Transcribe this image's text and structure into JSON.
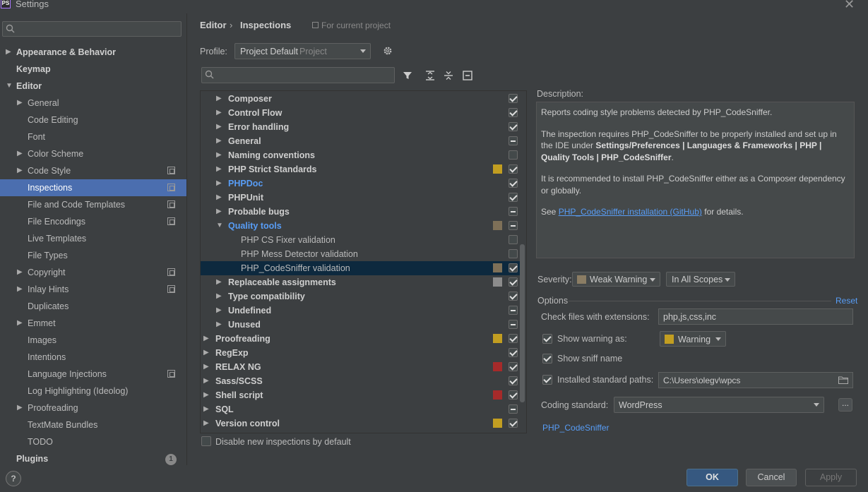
{
  "window": {
    "title": "Settings",
    "logo_text": "PS"
  },
  "sidebar": {
    "search_placeholder": "",
    "items": [
      {
        "label": "Appearance & Behavior",
        "bold": true,
        "arrow": "▶",
        "indent": 0
      },
      {
        "label": "Keymap",
        "bold": true,
        "arrow": "",
        "indent": 0
      },
      {
        "label": "Editor",
        "bold": true,
        "arrow": "▼",
        "indent": 0
      },
      {
        "label": "General",
        "arrow": "▶",
        "indent": 1
      },
      {
        "label": "Code Editing",
        "arrow": "",
        "indent": 1
      },
      {
        "label": "Font",
        "arrow": "",
        "indent": 1
      },
      {
        "label": "Color Scheme",
        "arrow": "▶",
        "indent": 1
      },
      {
        "label": "Code Style",
        "arrow": "▶",
        "indent": 1,
        "project": true
      },
      {
        "label": "Inspections",
        "arrow": "",
        "indent": 1,
        "project": true,
        "selected": true
      },
      {
        "label": "File and Code Templates",
        "arrow": "",
        "indent": 1,
        "project": true
      },
      {
        "label": "File Encodings",
        "arrow": "",
        "indent": 1,
        "project": true
      },
      {
        "label": "Live Templates",
        "arrow": "",
        "indent": 1
      },
      {
        "label": "File Types",
        "arrow": "",
        "indent": 1
      },
      {
        "label": "Copyright",
        "arrow": "▶",
        "indent": 1,
        "project": true
      },
      {
        "label": "Inlay Hints",
        "arrow": "▶",
        "indent": 1,
        "project": true
      },
      {
        "label": "Duplicates",
        "arrow": "",
        "indent": 1
      },
      {
        "label": "Emmet",
        "arrow": "▶",
        "indent": 1
      },
      {
        "label": "Images",
        "arrow": "",
        "indent": 1
      },
      {
        "label": "Intentions",
        "arrow": "",
        "indent": 1
      },
      {
        "label": "Language Injections",
        "arrow": "",
        "indent": 1,
        "project": true
      },
      {
        "label": "Log Highlighting (Ideolog)",
        "arrow": "",
        "indent": 1
      },
      {
        "label": "Proofreading",
        "arrow": "▶",
        "indent": 1
      },
      {
        "label": "TextMate Bundles",
        "arrow": "",
        "indent": 1
      },
      {
        "label": "TODO",
        "arrow": "",
        "indent": 1
      },
      {
        "label": "Plugins",
        "bold": true,
        "arrow": "",
        "indent": 0
      }
    ],
    "plugins_badge": "1"
  },
  "header": {
    "breadcrumb": [
      "Editor",
      "Inspections"
    ],
    "breadcrumb_sep": "›",
    "scope_note": "For current project"
  },
  "profile": {
    "label": "Profile:",
    "value": "Project Default",
    "scope": "Project"
  },
  "inspections": {
    "search_placeholder": "",
    "rows": [
      {
        "label": "Composer",
        "indent": 1,
        "arrow": "▶",
        "bold": true,
        "state": "checked",
        "severity": ""
      },
      {
        "label": "Control Flow",
        "indent": 1,
        "arrow": "▶",
        "bold": true,
        "state": "checked",
        "severity": ""
      },
      {
        "label": "Error handling",
        "indent": 1,
        "arrow": "▶",
        "bold": true,
        "state": "checked",
        "severity": ""
      },
      {
        "label": "General",
        "indent": 1,
        "arrow": "▶",
        "bold": true,
        "state": "partial",
        "severity": ""
      },
      {
        "label": "Naming conventions",
        "indent": 1,
        "arrow": "▶",
        "bold": true,
        "state": "unchecked",
        "severity": ""
      },
      {
        "label": "PHP Strict Standards",
        "indent": 1,
        "arrow": "▶",
        "bold": true,
        "state": "checked",
        "severity": "#c29e21"
      },
      {
        "label": "PHPDoc",
        "indent": 1,
        "arrow": "▶",
        "bold": true,
        "blue": true,
        "state": "checked",
        "severity": ""
      },
      {
        "label": "PHPUnit",
        "indent": 1,
        "arrow": "▶",
        "bold": true,
        "state": "checked",
        "severity": ""
      },
      {
        "label": "Probable bugs",
        "indent": 1,
        "arrow": "▶",
        "bold": true,
        "state": "partial",
        "severity": ""
      },
      {
        "label": "Quality tools",
        "indent": 1,
        "arrow": "▼",
        "bold": true,
        "blue": true,
        "state": "partial",
        "severity": "#7e7058"
      },
      {
        "label": "PHP CS Fixer validation",
        "indent": 2,
        "arrow": "",
        "state": "unchecked",
        "severity": ""
      },
      {
        "label": "PHP Mess Detector validation",
        "indent": 2,
        "arrow": "",
        "state": "unchecked",
        "severity": ""
      },
      {
        "label": "PHP_CodeSniffer validation",
        "indent": 2,
        "arrow": "",
        "state": "checked",
        "severity": "#7e7058",
        "selected": true
      },
      {
        "label": "Replaceable assignments",
        "indent": 1,
        "arrow": "▶",
        "bold": true,
        "state": "checked",
        "severity": "#8c8c8c"
      },
      {
        "label": "Type compatibility",
        "indent": 1,
        "arrow": "▶",
        "bold": true,
        "state": "checked",
        "severity": ""
      },
      {
        "label": "Undefined",
        "indent": 1,
        "arrow": "▶",
        "bold": true,
        "state": "partial",
        "severity": ""
      },
      {
        "label": "Unused",
        "indent": 1,
        "arrow": "▶",
        "bold": true,
        "state": "partial",
        "severity": ""
      },
      {
        "label": "Proofreading",
        "indent": 0,
        "arrow": "▶",
        "bold": true,
        "state": "checked",
        "severity": "#c29e21"
      },
      {
        "label": "RegExp",
        "indent": 0,
        "arrow": "▶",
        "bold": true,
        "state": "checked",
        "severity": ""
      },
      {
        "label": "RELAX NG",
        "indent": 0,
        "arrow": "▶",
        "bold": true,
        "state": "checked",
        "severity": "#a62a2a"
      },
      {
        "label": "Sass/SCSS",
        "indent": 0,
        "arrow": "▶",
        "bold": true,
        "state": "checked",
        "severity": ""
      },
      {
        "label": "Shell script",
        "indent": 0,
        "arrow": "▶",
        "bold": true,
        "state": "checked",
        "severity": "#a62a2a"
      },
      {
        "label": "SQL",
        "indent": 0,
        "arrow": "▶",
        "bold": true,
        "state": "partial",
        "severity": ""
      },
      {
        "label": "Version control",
        "indent": 0,
        "arrow": "▶",
        "bold": true,
        "state": "checked",
        "severity": "#c29e21"
      }
    ],
    "disable_new_label": "Disable new inspections by default"
  },
  "description": {
    "label": "Description:",
    "p1": "Reports coding style problems detected by PHP_CodeSniffer.",
    "p2_pre": "The inspection requires PHP_CodeSniffer to be properly installed and set up in the IDE under ",
    "p2_bold": "Settings/Preferences | Languages & Frameworks | PHP | Quality Tools | PHP_CodeSniffer",
    "p2_post": ".",
    "p3": "It is recommended to install PHP_CodeSniffer either as a Composer dependency or globally.",
    "p4_pre": "See ",
    "p4_link": "PHP_CodeSniffer installation (GitHub)",
    "p4_post": " for details."
  },
  "severity": {
    "label": "Severity:",
    "value": "Weak Warning",
    "scope": "In All Scopes"
  },
  "options": {
    "title": "Options",
    "reset": "Reset",
    "ext_label": "Check files with extensions:",
    "ext_value": "php,js,css,inc",
    "show_warning_label": "Show warning as:",
    "warning_value": "Warning",
    "sniff_name_label": "Show sniff name",
    "std_paths_label": "Installed standard paths:",
    "std_paths_value": "C:\\Users\\olegv\\wpcs",
    "coding_std_label": "Coding standard:",
    "coding_std_value": "WordPress",
    "browse_label": "...",
    "codesniffer_link": "PHP_CodeSniffer"
  },
  "buttons": {
    "ok": "OK",
    "cancel": "Cancel",
    "apply": "Apply",
    "help": "?"
  },
  "colors": {
    "accent": "#4b6eaf",
    "link": "#589df6",
    "primary_button": "#365880",
    "selected_row": "#0d293e"
  }
}
